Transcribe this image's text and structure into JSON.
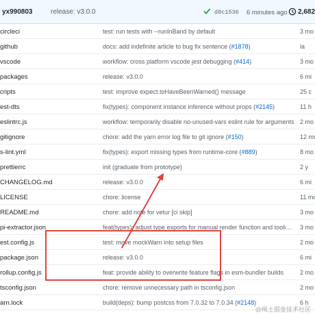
{
  "commit": {
    "author": "yx990803",
    "message": "release: v3.0.0",
    "sha": "d8c1536",
    "time_ago": "6 minutes ago",
    "commit_count": "2,682"
  },
  "files": [
    {
      "name": "circleci",
      "message": "test: run tests with --runInBand by default",
      "issue": "",
      "suffix": "",
      "age": "3 mo"
    },
    {
      "name": "github",
      "message": "docs: add indefinite article to bug fix sentence (",
      "issue": "#1878",
      "suffix": ")",
      "age": "la"
    },
    {
      "name": "vscode",
      "message": "workflow: cross platform vscode jest debugging (",
      "issue": "#414",
      "suffix": ")",
      "age": "3 mo"
    },
    {
      "name": "packages",
      "message": "release: v3.0.0",
      "issue": "",
      "suffix": "",
      "age": "6 mi"
    },
    {
      "name": "cripts",
      "message": "test: improve expect.toHaveBeenWarned() message",
      "issue": "",
      "suffix": "",
      "age": "25 c"
    },
    {
      "name": "est-dts",
      "message": "fix(types): component instance inference without props (",
      "issue": "#2145",
      "suffix": ")",
      "age": "11 h"
    },
    {
      "name": "eslintrc.js",
      "message": "workflow: temporarily disable no-unused-vars eslint rule for arguments",
      "issue": "",
      "suffix": "",
      "age": "2 mo"
    },
    {
      "name": "gitignore",
      "message": "chore: add the yarn error log file to git ignore (",
      "issue": "#150",
      "suffix": ")",
      "age": "12 mo"
    },
    {
      "name": "s-lint.yml",
      "message": "fix(types): export missing types from runtime-core (",
      "issue": "#889",
      "suffix": ")",
      "age": "8 mo"
    },
    {
      "name": "prettierrc",
      "message": "init (graduate from prototype)",
      "issue": "",
      "suffix": "",
      "age": "2 y"
    },
    {
      "name": "CHANGELOG.md",
      "message": "release: v3.0.0",
      "issue": "",
      "suffix": "",
      "age": "6 mi"
    },
    {
      "name": "LICENSE",
      "message": "chore: license",
      "issue": "",
      "suffix": "",
      "age": "11 mo"
    },
    {
      "name": "README.md",
      "message": "chore: add note for vetur [ci skip]",
      "issue": "",
      "suffix": "",
      "age": "3 mo"
    },
    {
      "name": "pi-extractor.json",
      "message": "feat(types): adjust type exports for manual render function and tooli…",
      "issue": "",
      "suffix": "",
      "age": "3 mo"
    },
    {
      "name": "est.config.js",
      "message": "test: move mockWarn into setup files",
      "issue": "",
      "suffix": "",
      "age": "2 mo"
    },
    {
      "name": "package.json",
      "message": "release: v3.0.0",
      "issue": "",
      "suffix": "",
      "age": "6 mi"
    },
    {
      "name": "rollup.config.js",
      "message": "feat: provide ability to overwrite feature flags in esm-bundler builds",
      "issue": "",
      "suffix": "",
      "age": "2 mo"
    },
    {
      "name": "tsconfig.json",
      "message": "chore: remove unnecessary path in tsconfig.json",
      "issue": "",
      "suffix": "",
      "age": "2 mo"
    },
    {
      "name": "arn.lock",
      "message": "build(deps): bump postcss from 7.0.32 to 7.0.34 (",
      "issue": "#2148",
      "suffix": ")",
      "age": "6 h"
    }
  ],
  "annotation": {
    "color": "#e0443e"
  },
  "watermark": "@稀土掘金技术社区"
}
